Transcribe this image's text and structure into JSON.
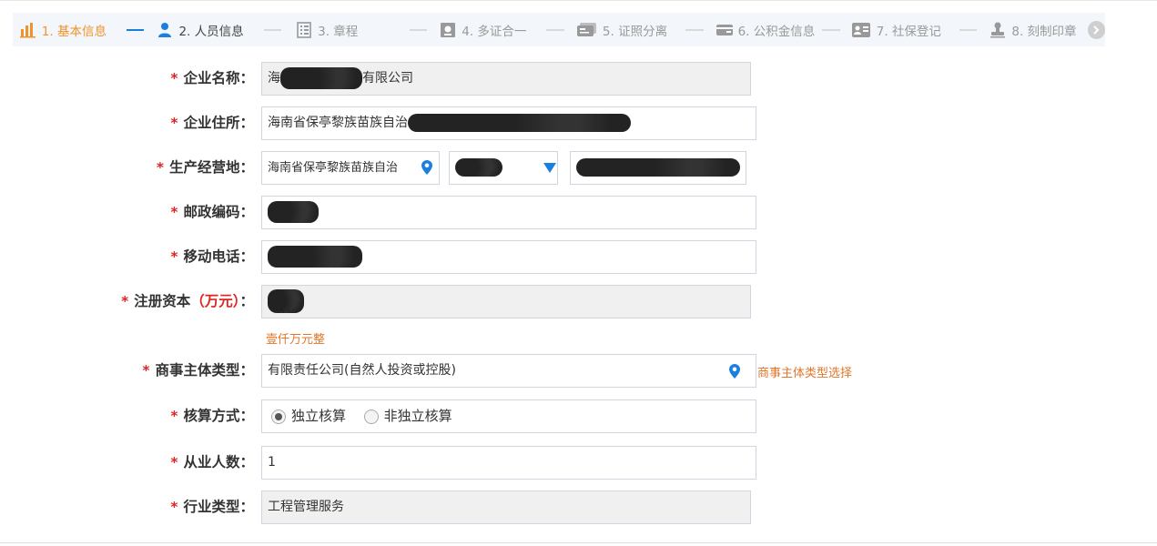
{
  "steps": [
    {
      "label": "1. 基本信息",
      "icon": "bar-chart-icon"
    },
    {
      "label": "2. 人员信息",
      "icon": "person-icon"
    },
    {
      "label": "3. 章程",
      "icon": "list-icon"
    },
    {
      "label": "4. 多证合一",
      "icon": "certificate-icon"
    },
    {
      "label": "5. 证照分离",
      "icon": "card-icon"
    },
    {
      "label": "6. 公积金信息",
      "icon": "wallet-icon"
    },
    {
      "label": "7. 社保登记",
      "icon": "id-card-icon"
    },
    {
      "label": "8. 刻制印章",
      "icon": "stamp-icon"
    }
  ],
  "colors": {
    "active": "#f0932b",
    "accent": "#1b7fe0",
    "required": "#e02424",
    "hint": "#e0762b"
  },
  "form": {
    "company_name": {
      "label": "企业名称：",
      "prefix": "海",
      "suffix": "有限公司"
    },
    "address": {
      "label": "企业住所：",
      "prefix": "海南省保亭黎族苗族自治"
    },
    "business_location": {
      "label": "生产经营地：",
      "region": "海南省保亭黎族苗族自治"
    },
    "postal_code": {
      "label": "邮政编码："
    },
    "mobile": {
      "label": "移动电话："
    },
    "capital": {
      "label": "注册资本",
      "unit": "（万元）",
      "colon": "：",
      "hint": "壹仟万元整"
    },
    "entity_type": {
      "label": "商事主体类型：",
      "value": "有限责任公司(自然人投资或控股)",
      "link": "商事主体类型选择"
    },
    "accounting": {
      "label": "核算方式：",
      "options": [
        "独立核算",
        "非独立核算"
      ],
      "selected": "独立核算"
    },
    "employees": {
      "label": "从业人数：",
      "value": "1"
    },
    "industry": {
      "label": "行业类型：",
      "value": "工程管理服务"
    }
  }
}
